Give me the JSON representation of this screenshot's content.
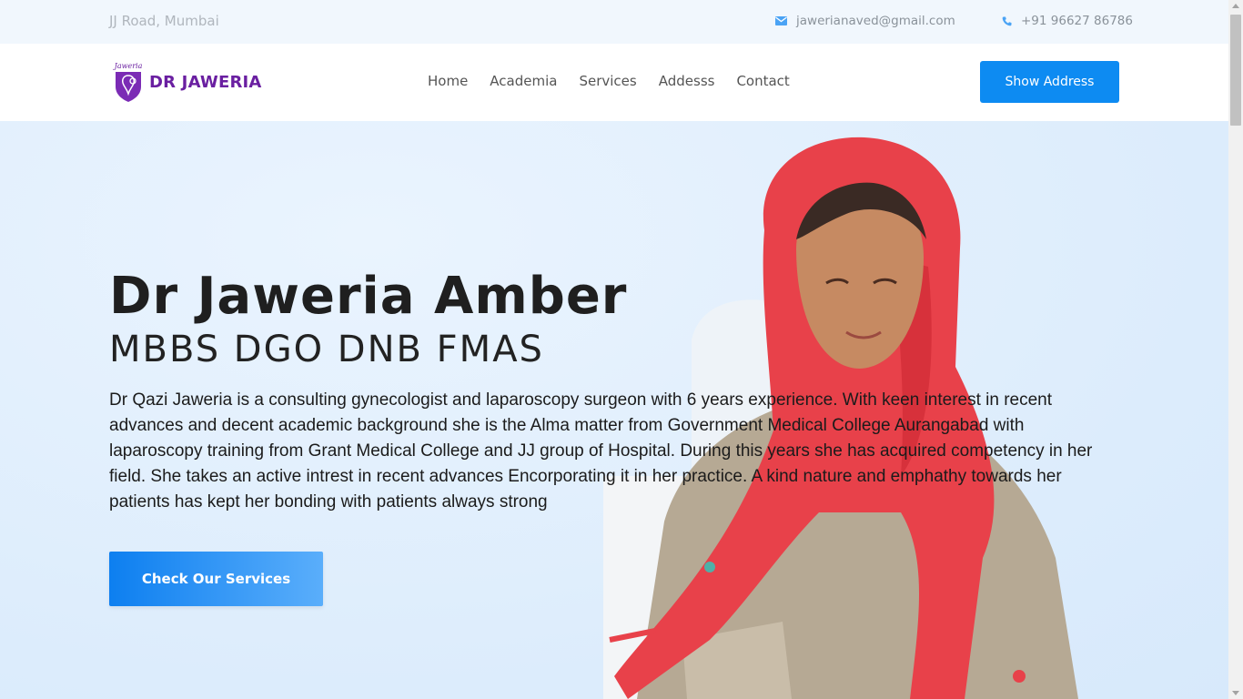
{
  "topbar": {
    "address": "JJ Road, Mumbai",
    "email": "jawerianaved@gmail.com",
    "phone": "+91 96627 86786",
    "email_icon": "envelope-icon",
    "phone_icon": "phone-icon"
  },
  "header": {
    "logo_small": "Jaweria",
    "logo_text": "DR JAWERIA",
    "nav": [
      "Home",
      "Academia",
      "Services",
      "Addesss",
      "Contact"
    ],
    "cta_label": "Show Address"
  },
  "hero": {
    "name": "Dr Jaweria Amber",
    "degrees": "MBBS DGO DNB FMAS",
    "description": "Dr Qazi Jaweria is a consulting gynecologist and laparoscopy surgeon with 6 years experience. With keen interest in recent advances and decent academic background she is the Alma matter from Government Medical College Aurangabad with laparoscopy training from Grant Medical College and JJ group of Hospital. During this years she has acquired competency in her field. She takes an active intrest in recent advances Encorporating it in her practice. A kind nature and emphathy towards her patients has kept her bonding with patients always strong",
    "button_label": "Check Our Services"
  },
  "colors": {
    "brand_purple": "#6a1fa1",
    "accent_blue": "#0d8bf2",
    "hero_bg": "#dcecfc"
  }
}
